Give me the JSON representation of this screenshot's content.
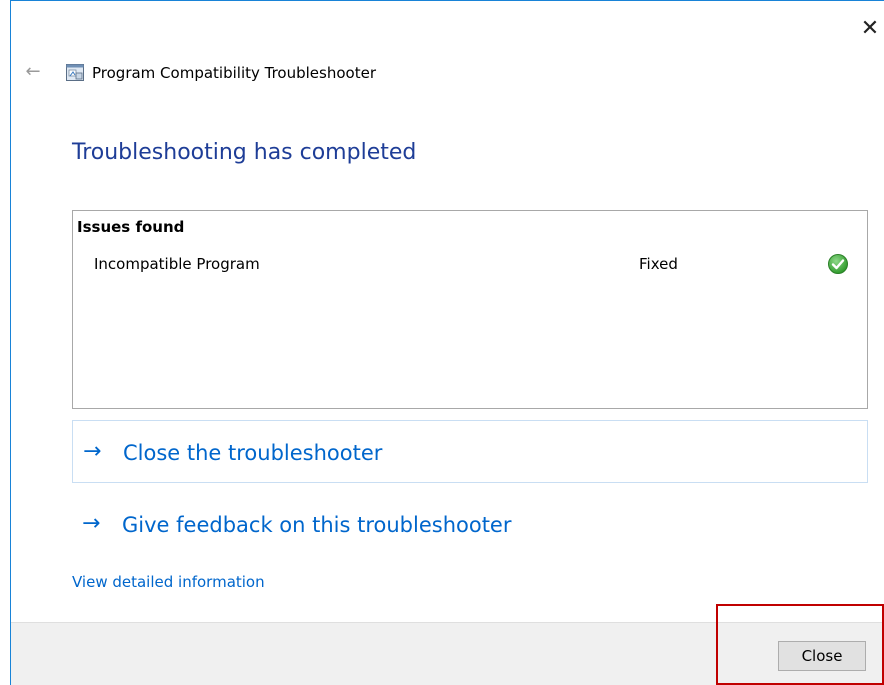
{
  "window": {
    "close_glyph": "✕",
    "back_glyph": "←"
  },
  "header": {
    "app_icon": "troubleshooter-app-icon",
    "title": "Program Compatibility Troubleshooter"
  },
  "main": {
    "heading": "Troubleshooting has completed",
    "issues": {
      "header": "Issues found",
      "rows": [
        {
          "name": "Incompatible Program",
          "status": "Fixed",
          "status_icon": "check-circle-icon",
          "status_color": "#3aa335"
        }
      ]
    },
    "actions": [
      {
        "arrow": "→",
        "label": "Close the troubleshooter"
      },
      {
        "arrow": "→",
        "label": "Give feedback on this troubleshooter"
      }
    ],
    "details_link": "View detailed information"
  },
  "footer": {
    "close_label": "Close"
  },
  "colors": {
    "heading": "#1e3d97",
    "link": "#0066cc",
    "accent_border": "#1883d7",
    "highlight": "#c00000",
    "footer_bg": "#f0f0f0"
  }
}
